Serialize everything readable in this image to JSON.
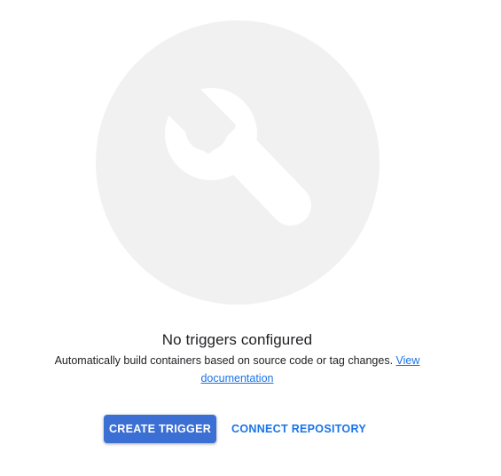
{
  "empty_state": {
    "illustration_icon": "wrench-icon",
    "title": "No triggers configured",
    "description": "Automatically build containers based on source code or tag changes.",
    "doc_link_label": "View documentation"
  },
  "actions": {
    "primary_label": "CREATE TRIGGER",
    "secondary_label": "CONNECT REPOSITORY"
  },
  "colors": {
    "primary_button": "#3b6fd4",
    "link": "#1a73e8",
    "illustration_circle": "#f1f1f1"
  }
}
